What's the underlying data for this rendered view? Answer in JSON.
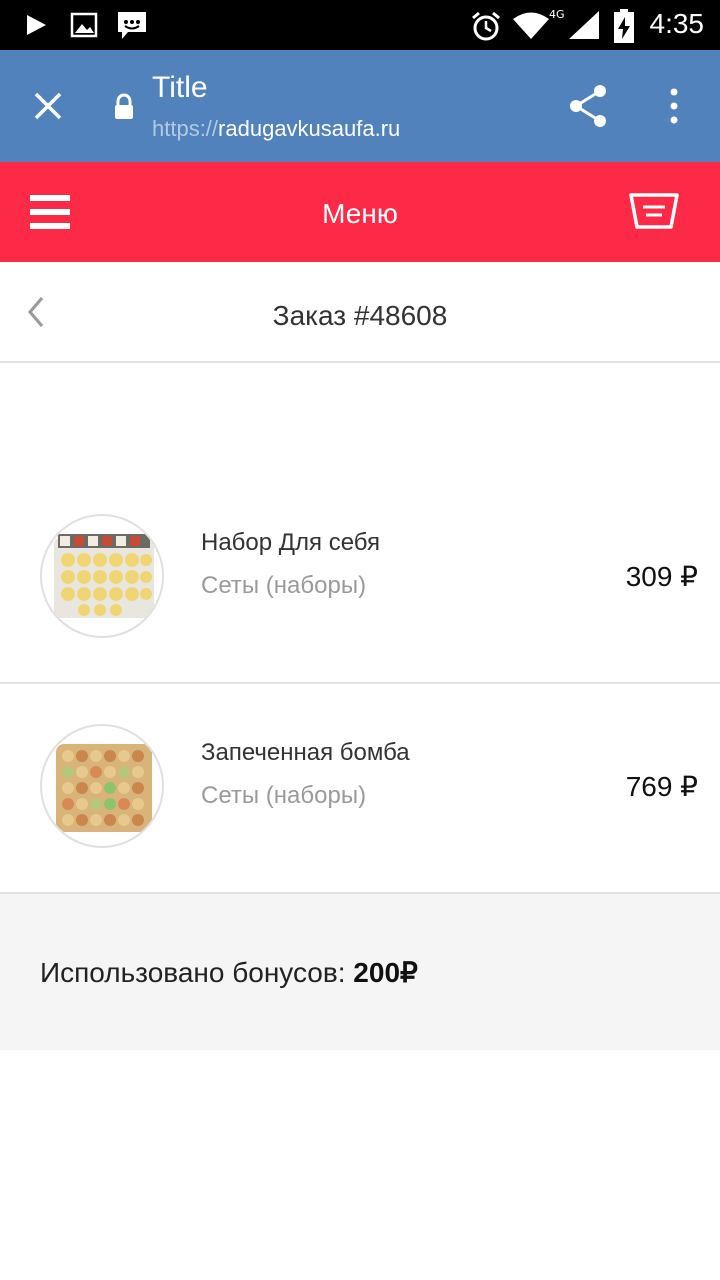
{
  "status_bar": {
    "time": "4:35",
    "network": "4G",
    "icons": [
      "play-icon",
      "image-icon",
      "chat-icon",
      "alarm-icon",
      "wifi-icon",
      "signal-icon",
      "battery-charging-icon"
    ]
  },
  "toolbar": {
    "title": "Title",
    "url_scheme": "https://",
    "url_host": "radugavkusaufa.ru",
    "icons": [
      "close-icon",
      "lock-icon",
      "share-icon",
      "more-vert-icon"
    ],
    "color": "#5182bc"
  },
  "app_header": {
    "title": "Меню",
    "icons": [
      "hamburger-menu-icon",
      "basket-icon"
    ],
    "color": "#fc2a46"
  },
  "order": {
    "title": "Заказ #48608",
    "back_icon": "chevron-left-icon"
  },
  "items": [
    {
      "name": "Набор Для себя",
      "category": "Сеты (наборы)",
      "price": "309 ₽"
    },
    {
      "name": "Запеченная бомба",
      "category": "Сеты (наборы)",
      "price": "769 ₽"
    }
  ],
  "bonus": {
    "label": "Использовано бонусов: ",
    "value": "200₽"
  }
}
